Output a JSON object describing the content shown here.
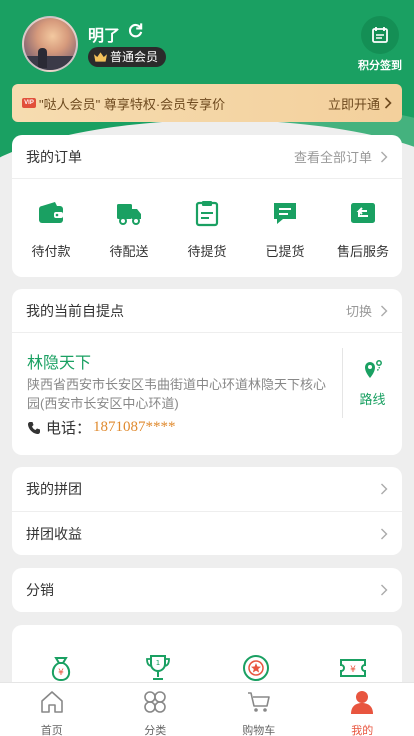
{
  "colors": {
    "brand": "#1aa062",
    "accent": "#e8553f",
    "vip_text": "#6e4a1f",
    "phone": "#e08a2e"
  },
  "profile": {
    "username": "明了",
    "member_level": "普通会员",
    "checkin_label": "积分签到"
  },
  "vip_bar": {
    "text": "\"哒人会员\" 尊享特权·会员专享价",
    "action": "立即开通"
  },
  "orders": {
    "title": "我的订单",
    "view_all": "查看全部订单",
    "items": [
      {
        "label": "待付款",
        "icon": "wallet-icon"
      },
      {
        "label": "待配送",
        "icon": "truck-icon"
      },
      {
        "label": "待提货",
        "icon": "clipboard-icon"
      },
      {
        "label": "已提货",
        "icon": "message-check-icon"
      },
      {
        "label": "售后服务",
        "icon": "return-icon"
      }
    ]
  },
  "pickup": {
    "title": "我的当前自提点",
    "switch": "切换",
    "name": "林隐天下",
    "address": "陕西省西安市长安区韦曲街道中心环道林隐天下核心园(西安市长安区中心环道)",
    "phone_label": "电话：",
    "phone": "1871087****",
    "route": "路线"
  },
  "group": {
    "my_group": "我的拼团",
    "group_income": "拼团收益"
  },
  "distribution": {
    "label": "分销"
  },
  "tools": [
    {
      "icon": "money-bag-icon"
    },
    {
      "icon": "trophy-icon"
    },
    {
      "icon": "star-badge-icon"
    },
    {
      "icon": "ticket-icon"
    }
  ],
  "tabbar": [
    {
      "label": "首页",
      "icon": "home-icon"
    },
    {
      "label": "分类",
      "icon": "category-icon"
    },
    {
      "label": "购物车",
      "icon": "cart-icon"
    },
    {
      "label": "我的",
      "icon": "user-icon",
      "active": true
    }
  ]
}
